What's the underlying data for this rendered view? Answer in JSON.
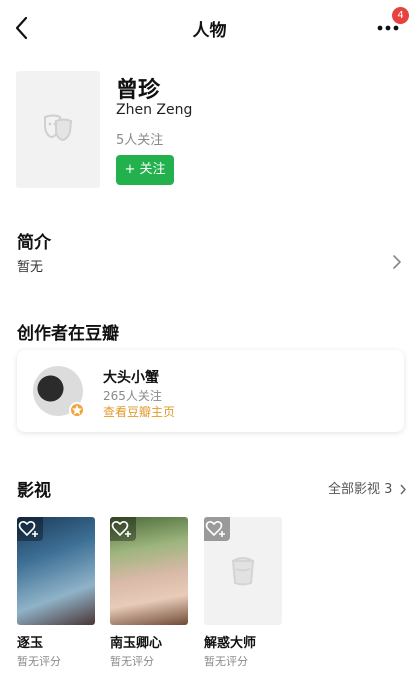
{
  "header": {
    "title": "人物",
    "notification_count": "4"
  },
  "person": {
    "name_cn": "曾珍",
    "name_en": "Zhen Zeng",
    "followers": "5人关注",
    "follow_label": "+ 关注"
  },
  "intro": {
    "title": "简介",
    "text": "暂无"
  },
  "creator": {
    "section_title": "创作者在豆瓣",
    "name": "大头小蟹",
    "followers": "265人关注",
    "link_label": "查看豆瓣主页"
  },
  "works": {
    "title": "影视",
    "all_label": "全部影视 3",
    "items": [
      {
        "title": "逐玉",
        "rating": "暂无评分"
      },
      {
        "title": "南玉卿心",
        "rating": "暂无评分"
      },
      {
        "title": "解惑大师",
        "rating": "暂无评分"
      }
    ]
  },
  "colors": {
    "accent_green": "#22b14c",
    "link_orange": "#e09b2d",
    "badge_red": "#e64340"
  },
  "icons": [
    "back-arrow-icon",
    "more-dots-icon",
    "drama-mask-icon",
    "chevron-right-icon",
    "star-badge-icon",
    "heart-plus-icon",
    "cup-placeholder-icon"
  ]
}
